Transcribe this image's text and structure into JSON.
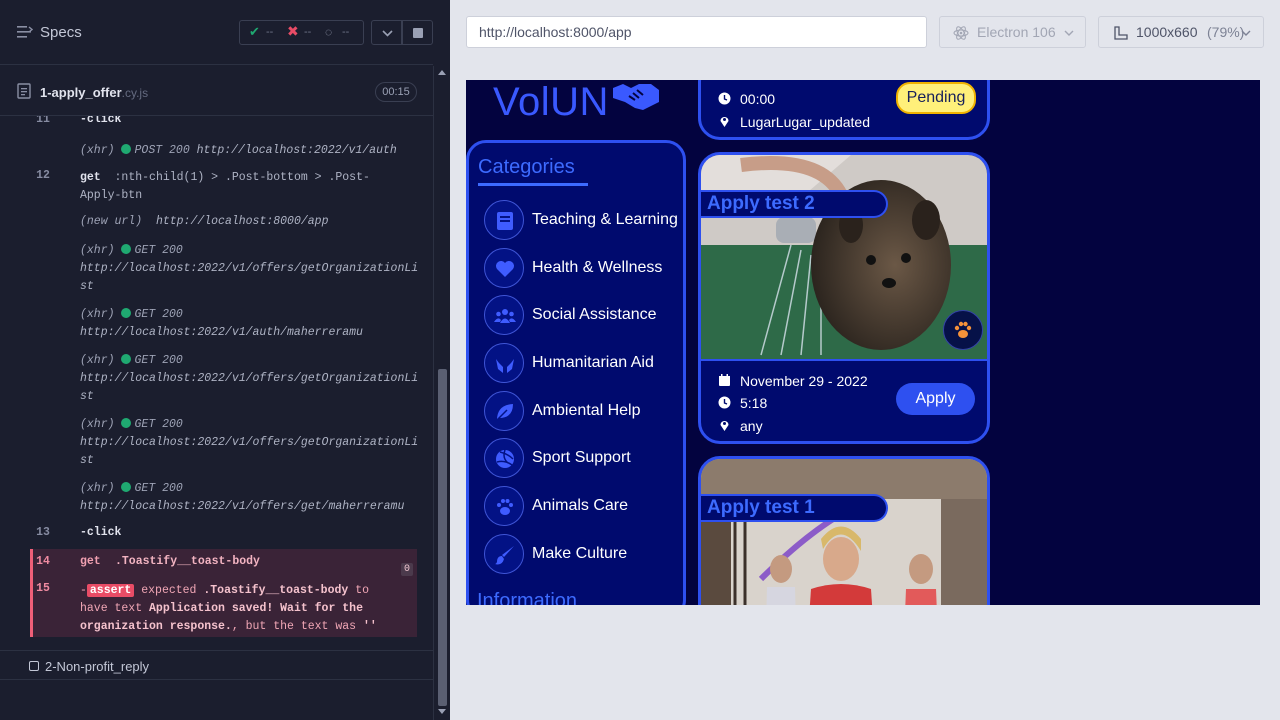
{
  "runner": {
    "header_title": "Specs",
    "stats": {
      "passed": "--",
      "failed": "--",
      "pending": "--"
    },
    "spec": {
      "name": "1-apply_offer",
      "ext": ".cy.js",
      "duration": "00:15"
    },
    "commands": [
      {
        "num": "11",
        "name": "-click"
      },
      {
        "kind": "(xhr)",
        "method": "POST 200",
        "url": "http://localhost:2022/v1/auth"
      },
      {
        "num": "12",
        "name": "get",
        "selector": ":nth-child(1) > .Post-bottom > .Post-Apply-btn"
      },
      {
        "kind": "(new url)",
        "url": "http://localhost:8000/app"
      },
      {
        "kind": "(xhr)",
        "method": "GET 200",
        "url": "http://localhost:2022/v1/offers/getOrganizationList"
      },
      {
        "kind": "(xhr)",
        "method": "GET 200",
        "url": "http://localhost:2022/v1/auth/maherreramu"
      },
      {
        "kind": "(xhr)",
        "method": "GET 200",
        "url": "http://localhost:2022/v1/offers/getOrganizationList"
      },
      {
        "kind": "(xhr)",
        "method": "GET 200",
        "url": "http://localhost:2022/v1/offers/getOrganizationList"
      },
      {
        "kind": "(xhr)",
        "method": "GET 200",
        "url": "http://localhost:2022/v1/offers/get/maherreramu"
      },
      {
        "num": "13",
        "name": "-click"
      },
      {
        "num": "14",
        "name": "get",
        "selector": ".Toastify__toast-body",
        "badge": "0"
      },
      {
        "num": "15",
        "assert_tag": "assert",
        "assert_expected": "expected",
        "assert_selector": ".Toastify__toast-body",
        "assert_to": "to",
        "assert_have": "have text",
        "assert_text": "Application saved! Wait for the organization response.",
        "assert_but": ", but the text was",
        "assert_actual": "''"
      }
    ],
    "next_spec": "2-Non-profit_reply"
  },
  "browser": {
    "url": "http://localhost:8000/app",
    "browser_name": "Electron 106",
    "viewport": "1000x660",
    "zoom": "(79%)"
  },
  "app": {
    "brand": "VolUN",
    "categories_title": "Categories",
    "categories": [
      {
        "label": "Teaching & Learning",
        "icon": "book-icon"
      },
      {
        "label": "Health & Wellness",
        "icon": "heart-icon"
      },
      {
        "label": "Social Assistance",
        "icon": "people-icon"
      },
      {
        "label": "Humanitarian Aid",
        "icon": "hands-icon"
      },
      {
        "label": "Ambiental Help",
        "icon": "leaf-icon"
      },
      {
        "label": "Sport Support",
        "icon": "volleyball-icon"
      },
      {
        "label": "Animals Care",
        "icon": "paw-icon"
      },
      {
        "label": "Make Culture",
        "icon": "brush-icon"
      }
    ],
    "info_title": "Information",
    "offers": [
      {
        "time": "00:00",
        "place": "LugarLugar_updated",
        "status": "Pending"
      },
      {
        "title": "Apply test 2",
        "date": "November 29 - 2022",
        "time": "5:18",
        "place": "any",
        "action": "Apply"
      },
      {
        "title": "Apply test 1"
      }
    ],
    "colors": {
      "accent": "#2e50f0",
      "background": "#03033f",
      "pending": "#fff07a"
    }
  }
}
